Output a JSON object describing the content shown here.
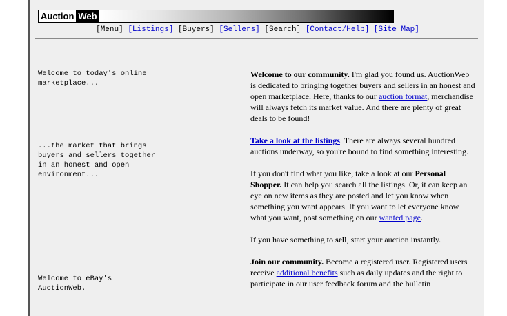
{
  "logo": {
    "part1": "Auction",
    "part2": "Web"
  },
  "nav": {
    "menu": "[Menu]",
    "listings": "[Listings]",
    "buyers": "[Buyers]",
    "sellers": "[Sellers]",
    "search": "[Search]",
    "contact": "[Contact/Help]",
    "sitemap": "[Site Map]"
  },
  "left": {
    "block1": "Welcome to today's online\nmarketplace...",
    "block2": "...the market that brings\nbuyers and sellers together\nin an honest and open\nenvironment...",
    "block3": "Welcome to eBay's\nAuctionWeb."
  },
  "right": {
    "p1_bold": "Welcome to our community.",
    "p1_text1": " I'm glad you found us. AuctionWeb is dedicated to bringing together buyers and sellers in an honest and open marketplace. Here, thanks to our ",
    "p1_link": "auction format",
    "p1_text2": ", merchandise will always fetch its market value. And there are plenty of great deals to be found!",
    "p2_link": "Take a look at the listings",
    "p2_text": ". There are always several hundred auctions underway, so you're bound to find something interesting.",
    "p3_text1": "If you don't find what you like, take a look at our ",
    "p3_bold": "Personal Shopper.",
    "p3_text2": " It can help you search all the listings. Or, it can keep an eye on new items as they are posted and let you know when something you want appears. If you want to let everyone know what you want, post something on our ",
    "p3_link": "wanted page",
    "p3_text3": ".",
    "p4_text1": "If you have something to ",
    "p4_bold": "sell",
    "p4_text2": ", start your auction instantly.",
    "p5_bold": "Join our community.",
    "p5_text1": " Become a registered user. Registered users receive ",
    "p5_link": "additional benefits",
    "p5_text2": " such as daily updates and the right to participate in our user feedback forum and the bulletin"
  }
}
